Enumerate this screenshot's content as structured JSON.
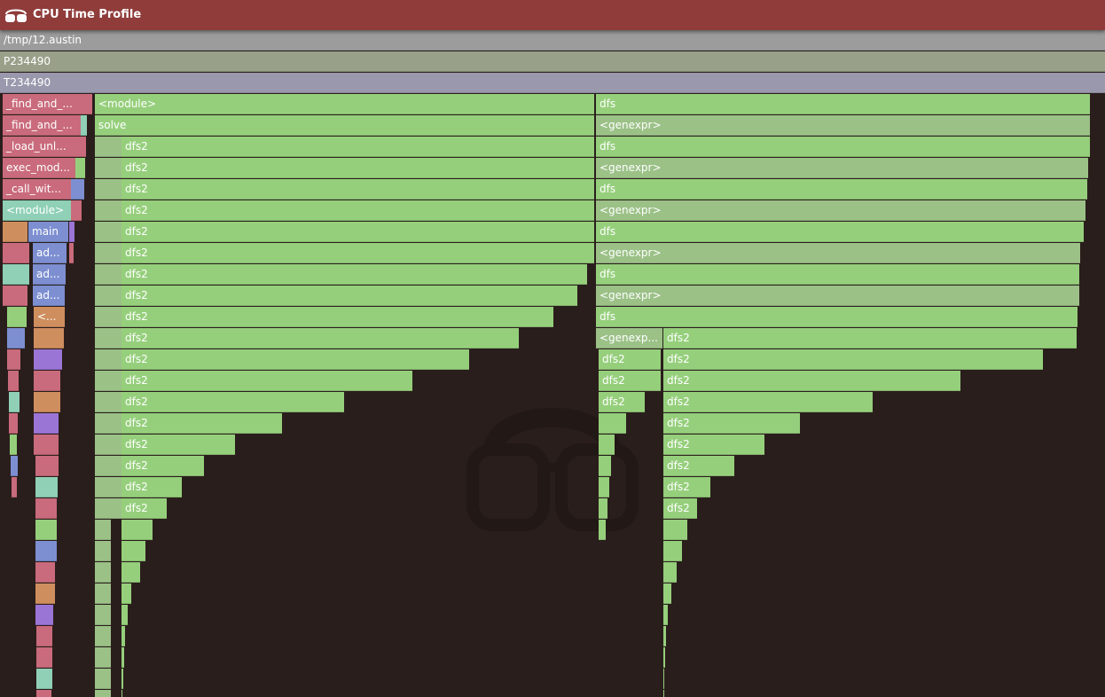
{
  "window": {
    "title": "CPU Time Profile",
    "logo_icon": "austin-glasses-logo-icon"
  },
  "labels": {
    "file": "/tmp/12.austin",
    "process": "P234490",
    "thread": "T234490",
    "find1": "_find_and_...",
    "find2": "_find_and_...",
    "load": "_load_unl...",
    "exec": "exec_mod...",
    "call": "_call_wit...",
    "module_small": "<module>",
    "main": "main",
    "ad": "ad...",
    "lt": "<...",
    "module": "<module>",
    "solve": "solve",
    "dfs2": "dfs2",
    "dfs": "dfs",
    "genexpr": "<genexpr>",
    "genexpr_short": "<genexp..."
  },
  "colors": {
    "title_bar": "#8f3c3a",
    "background": "#2a1e1c",
    "file_row": "#9c9c9c",
    "process_row": "#98a08a",
    "thread_row": "#9a98ad",
    "frame_green": "#96cf7c",
    "frame_green_dim": "#9bc187",
    "frame_red": "#c96b7c",
    "frame_teal": "#8fd0b6",
    "frame_blue": "#7d8fd1",
    "frame_orange": "#cf8e5e",
    "frame_purple": "#9b75d6"
  }
}
